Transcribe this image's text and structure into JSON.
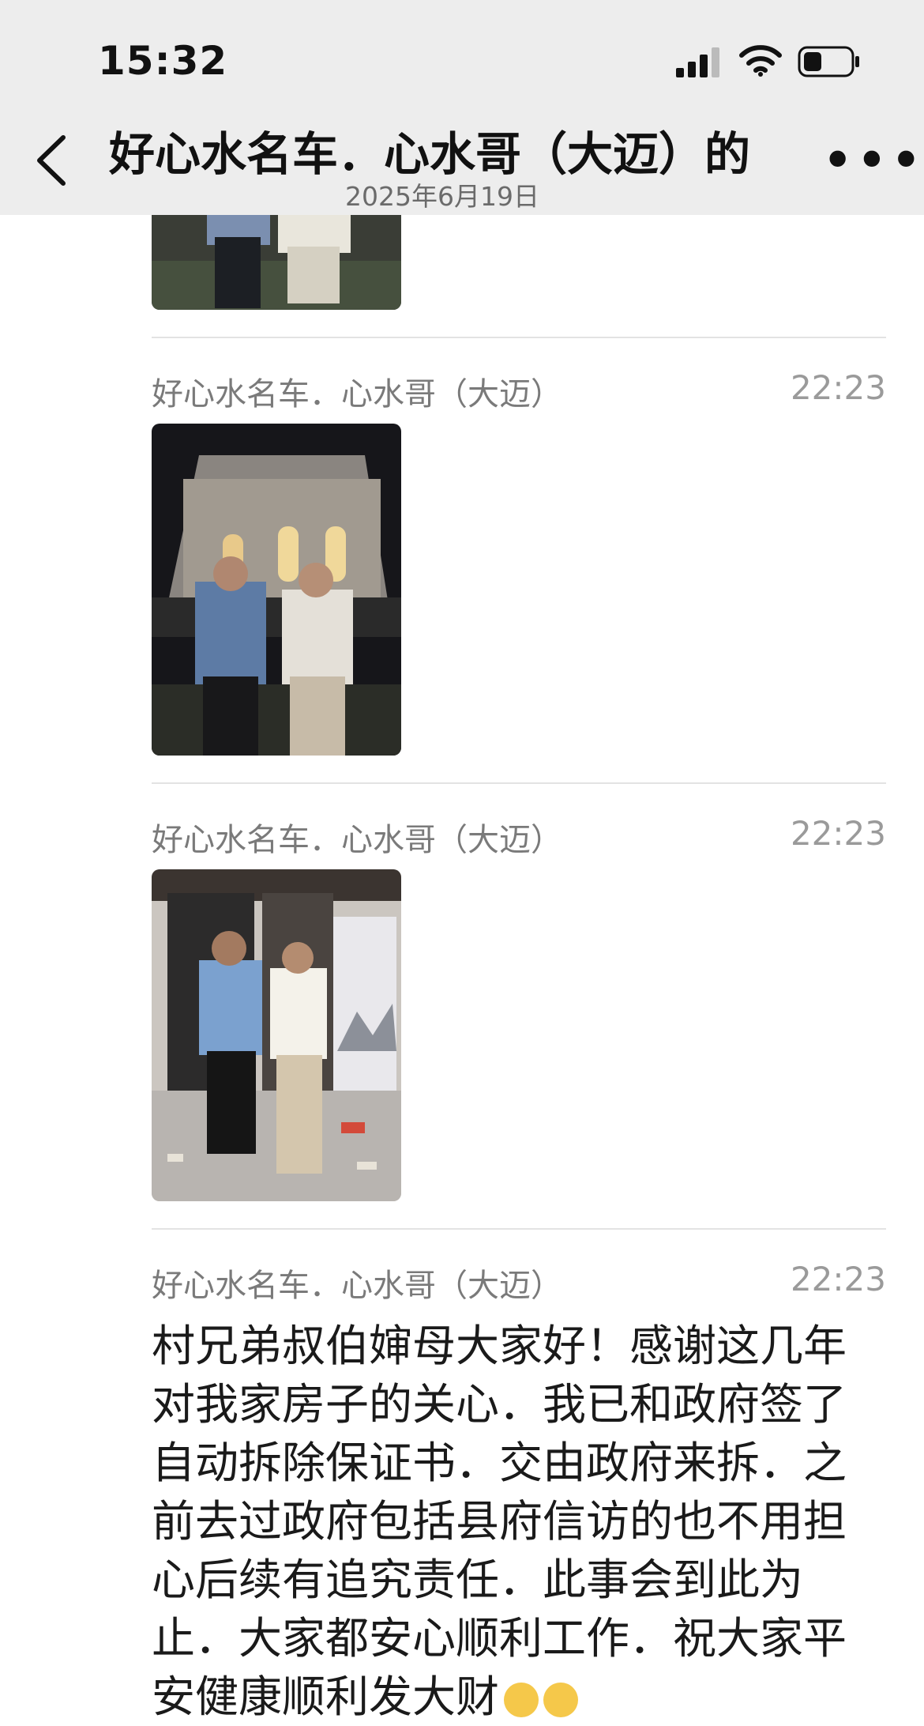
{
  "status_bar": {
    "time": "15:32"
  },
  "header": {
    "title": "好心水名车．心水哥（大迈）的",
    "date": "2025年6月19日",
    "more": "•••"
  },
  "messages": [
    {
      "sender": "好心水名车．心水哥（大迈）",
      "time": "22:23",
      "type": "image"
    },
    {
      "sender": "好心水名车．心水哥（大迈）",
      "time": "22:23",
      "type": "image"
    },
    {
      "sender": "好心水名车．心水哥（大迈）",
      "time": "22:23",
      "type": "text",
      "text": "村兄弟叔伯婶母大家好！感谢这几年对我家房子的关心．我已和政府签了自动拆除保证书．交由政府来拆．之前去过政府包括县府信访的也不用担心后续有追究责任．此事会到此为止．大家都安心顺利工作．祝大家平安健康顺利发大财"
    }
  ]
}
